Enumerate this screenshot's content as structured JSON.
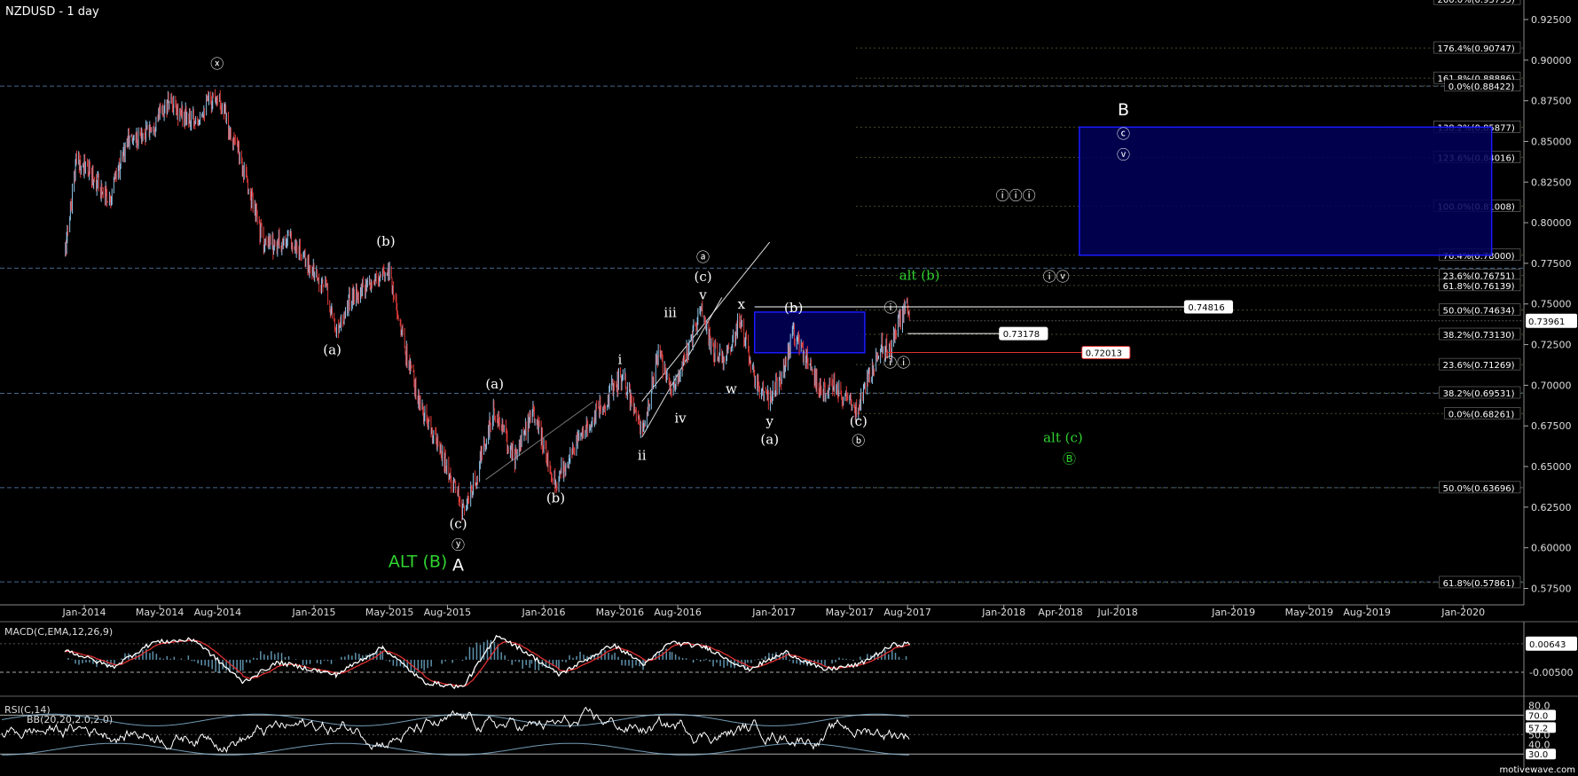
{
  "title": "NZDUSD - 1 day",
  "watermark": "motivewave.com",
  "colors": {
    "background": "#000000",
    "up": "#8fc3e6",
    "down": "#e03b3b",
    "grid": "#46668c",
    "box": "#1a1aff",
    "box_fill": "#00005a",
    "green": "#2fd22f",
    "macd": "#ffffff",
    "signal": "#e03030",
    "hist": "#76b5d6"
  },
  "chart_data": [
    {
      "type": "candlestick",
      "name": "price",
      "x_ticks": [
        "Jan-2014",
        "May-2014",
        "Aug-2014",
        "Jan-2015",
        "May-2015",
        "Aug-2015",
        "Jan-2016",
        "May-2016",
        "Aug-2016",
        "Jan-2017",
        "May-2017",
        "Aug-2017",
        "Jan-2018",
        "Apr-2018",
        "Jul-2018",
        "Jan-2019",
        "May-2019",
        "Aug-2019",
        "Jan-2020"
      ],
      "y_ticks": [
        "0.92500",
        "0.90000",
        "0.87500",
        "0.85000",
        "0.82500",
        "0.80000",
        "0.77500",
        "0.75000",
        "0.72500",
        "0.70000",
        "0.67500",
        "0.65000",
        "0.62500",
        "0.60000",
        "0.57500"
      ],
      "ylim": [
        0.566,
        0.937
      ],
      "last_price": "0.73961",
      "last_price_hidden": "0.74287",
      "anchor_points": [
        {
          "date": "2013-12-01",
          "price": 0.78
        },
        {
          "date": "2013-12-20",
          "price": 0.84
        },
        {
          "date": "2014-01-15",
          "price": 0.828
        },
        {
          "date": "2014-02-10",
          "price": 0.815
        },
        {
          "date": "2014-03-10",
          "price": 0.85
        },
        {
          "date": "2014-04-10",
          "price": 0.856
        },
        {
          "date": "2014-05-15",
          "price": 0.873
        },
        {
          "date": "2014-06-20",
          "price": 0.862
        },
        {
          "date": "2014-07-31",
          "price": 0.88
        },
        {
          "date": "2014-09-05",
          "price": 0.84
        },
        {
          "date": "2014-10-15",
          "price": 0.785
        },
        {
          "date": "2014-11-25",
          "price": 0.79
        },
        {
          "date": "2014-12-20",
          "price": 0.775
        },
        {
          "date": "2015-01-20",
          "price": 0.76
        },
        {
          "date": "2015-02-05",
          "price": 0.733
        },
        {
          "date": "2015-03-01",
          "price": 0.755
        },
        {
          "date": "2015-04-01",
          "price": 0.76
        },
        {
          "date": "2015-04-30",
          "price": 0.772
        },
        {
          "date": "2015-05-25",
          "price": 0.723
        },
        {
          "date": "2015-06-20",
          "price": 0.685
        },
        {
          "date": "2015-07-25",
          "price": 0.655
        },
        {
          "date": "2015-08-24",
          "price": 0.625
        },
        {
          "date": "2015-09-05",
          "price": 0.63
        },
        {
          "date": "2015-10-15",
          "price": 0.685
        },
        {
          "date": "2015-11-15",
          "price": 0.655
        },
        {
          "date": "2015-12-15",
          "price": 0.683
        },
        {
          "date": "2016-01-20",
          "price": 0.64
        },
        {
          "date": "2016-03-01",
          "price": 0.67
        },
        {
          "date": "2016-04-15",
          "price": 0.695
        },
        {
          "date": "2016-05-05",
          "price": 0.707
        },
        {
          "date": "2016-06-05",
          "price": 0.67
        },
        {
          "date": "2016-07-01",
          "price": 0.72
        },
        {
          "date": "2016-07-25",
          "price": 0.698
        },
        {
          "date": "2016-09-07",
          "price": 0.745
        },
        {
          "date": "2016-09-25",
          "price": 0.722
        },
        {
          "date": "2016-10-15",
          "price": 0.715
        },
        {
          "date": "2016-11-08",
          "price": 0.74
        },
        {
          "date": "2016-12-01",
          "price": 0.705
        },
        {
          "date": "2016-12-23",
          "price": 0.69
        },
        {
          "date": "2017-01-15",
          "price": 0.708
        },
        {
          "date": "2017-02-01",
          "price": 0.733
        },
        {
          "date": "2017-02-20",
          "price": 0.718
        },
        {
          "date": "2017-03-15",
          "price": 0.698
        },
        {
          "date": "2017-04-10",
          "price": 0.7
        },
        {
          "date": "2017-05-10",
          "price": 0.683
        },
        {
          "date": "2017-06-10",
          "price": 0.712
        },
        {
          "date": "2017-06-20",
          "price": 0.725
        },
        {
          "date": "2017-07-05",
          "price": 0.72
        },
        {
          "date": "2017-07-27",
          "price": 0.75
        },
        {
          "date": "2017-08-01",
          "price": 0.744
        },
        {
          "date": "2017-08-07",
          "price": 0.7396
        }
      ],
      "horizontal_levels": [
        0.884,
        0.772,
        0.695,
        0.637,
        0.579
      ],
      "fib_labels": [
        {
          "label": "200.0%(0.93755)",
          "price": 0.9375
        },
        {
          "label": "176.4%(0.90747)",
          "price": 0.9075
        },
        {
          "label": "161.8%(0.88886)",
          "price": 0.8889
        },
        {
          "label": "0.0%(0.88422)",
          "price": 0.8842
        },
        {
          "label": "138.2%(0.85877)",
          "price": 0.8588
        },
        {
          "label": "123.6%(0.84016)",
          "price": 0.8402
        },
        {
          "label": "100.0%(0.81008)",
          "price": 0.8101
        },
        {
          "label": "76.4%(0.78000)",
          "price": 0.78
        },
        {
          "label": "23.6%(0.76751)",
          "price": 0.7675
        },
        {
          "label": "61.8%(0.76139)",
          "price": 0.7614
        },
        {
          "label": "50.0%(0.74634)",
          "price": 0.7463
        },
        {
          "label": "38.2%(0.73130)",
          "price": 0.7313
        },
        {
          "label": "23.6%(0.71269)",
          "price": 0.7127
        },
        {
          "label": "38.2%(0.69531)",
          "price": 0.6953
        },
        {
          "label": "0.0%(0.68261)",
          "price": 0.6826
        },
        {
          "label": "50.0%(0.63696)",
          "price": 0.637
        },
        {
          "label": "61.8%(0.57861)",
          "price": 0.5786
        }
      ],
      "price_boxes": [
        {
          "label": "0.74816",
          "price": 0.7482,
          "color": "#ffffff",
          "start": "2016-12-01",
          "end": "2018-10-15"
        },
        {
          "label": "0.73178",
          "price": 0.7318,
          "color": "#ffffff",
          "start": "2017-08-01",
          "end": "2017-12-25"
        },
        {
          "label": "0.72013",
          "price": 0.7201,
          "color": "#e03030",
          "start": "2017-07-01",
          "end": "2018-05-05"
        }
      ],
      "target_boxes": [
        {
          "start": "2018-05-01",
          "end": "2020-02-15",
          "top": 0.8588,
          "bottom": 0.78
        },
        {
          "start": "2016-12-01",
          "end": "2017-05-25",
          "top": 0.745,
          "bottom": 0.72
        }
      ],
      "wave_labels": [
        {
          "text": "ⓧ",
          "date": "2014-07-31",
          "price": 0.895,
          "cls": "wave"
        },
        {
          "text": "(b)",
          "date": "2015-04-25",
          "price": 0.786,
          "cls": "wave"
        },
        {
          "text": "(a)",
          "date": "2015-01-30",
          "price": 0.719,
          "cls": "wave"
        },
        {
          "text": "(a)",
          "date": "2015-10-15",
          "price": 0.698,
          "cls": "wave"
        },
        {
          "text": "(b)",
          "date": "2016-01-20",
          "price": 0.628,
          "cls": "wave"
        },
        {
          "text": "(c)",
          "date": "2015-08-18",
          "price": 0.612,
          "cls": "wave"
        },
        {
          "text": "ⓨ",
          "date": "2015-08-18",
          "price": 0.599,
          "cls": "wave"
        },
        {
          "text": "A",
          "date": "2015-08-18",
          "price": 0.586,
          "cls": "wavebig"
        },
        {
          "text": "ALT (B)",
          "date": "2015-06-15",
          "price": 0.588,
          "cls": "wavebig green"
        },
        {
          "text": "i",
          "date": "2016-05-01",
          "price": 0.713,
          "cls": "wave"
        },
        {
          "text": "ii",
          "date": "2016-06-05",
          "price": 0.654,
          "cls": "wave"
        },
        {
          "text": "iii",
          "date": "2016-07-20",
          "price": 0.742,
          "cls": "wave"
        },
        {
          "text": "iv",
          "date": "2016-08-05",
          "price": 0.677,
          "cls": "wave"
        },
        {
          "text": "v",
          "date": "2016-09-10",
          "price": 0.753,
          "cls": "wave"
        },
        {
          "text": "ⓐ",
          "date": "2016-09-10",
          "price": 0.776,
          "cls": "wave"
        },
        {
          "text": "(c)",
          "date": "2016-09-10",
          "price": 0.764,
          "cls": "wave"
        },
        {
          "text": "x",
          "date": "2016-11-10",
          "price": 0.747,
          "cls": "wave"
        },
        {
          "text": "w",
          "date": "2016-10-25",
          "price": 0.695,
          "cls": "wave"
        },
        {
          "text": "y",
          "date": "2016-12-25",
          "price": 0.675,
          "cls": "wave"
        },
        {
          "text": "(a)",
          "date": "2016-12-25",
          "price": 0.664,
          "cls": "wave"
        },
        {
          "text": "(b)",
          "date": "2017-02-01",
          "price": 0.745,
          "cls": "wave"
        },
        {
          "text": "(c)",
          "date": "2017-05-15",
          "price": 0.675,
          "cls": "wave"
        },
        {
          "text": "ⓑ",
          "date": "2017-05-15",
          "price": 0.663,
          "cls": "wave"
        },
        {
          "text": "ⓘ",
          "date": "2017-07-05",
          "price": 0.745,
          "cls": "wave"
        },
        {
          "text": "ⓘⓘ",
          "date": "2017-07-15",
          "price": 0.711,
          "cls": "wave"
        },
        {
          "text": "alt (b)",
          "date": "2017-08-20",
          "price": 0.765,
          "cls": "wave green"
        },
        {
          "text": "ⓘⓘⓘ",
          "date": "2018-01-20",
          "price": 0.814,
          "cls": "wave"
        },
        {
          "text": "ⓘⓥ",
          "date": "2018-03-25",
          "price": 0.764,
          "cls": "wave"
        },
        {
          "text": "B",
          "date": "2018-07-10",
          "price": 0.866,
          "cls": "wavebig"
        },
        {
          "text": "ⓒ",
          "date": "2018-07-10",
          "price": 0.852,
          "cls": "wave"
        },
        {
          "text": "ⓥ",
          "date": "2018-07-10",
          "price": 0.839,
          "cls": "wave"
        },
        {
          "text": "alt (c)",
          "date": "2018-04-05",
          "price": 0.665,
          "cls": "wave green"
        },
        {
          "text": "Ⓑ",
          "date": "2018-04-15",
          "price": 0.652,
          "cls": "wave green"
        }
      ]
    },
    {
      "type": "line",
      "name": "MACD(C,EMA,12,26,9)",
      "title": "MACD(C,EMA,12,26,9)",
      "y_ticks": [
        "0.00643",
        "-0.00500"
      ],
      "ylim": [
        -0.0135,
        0.0145
      ],
      "series": [
        {
          "name": "MACD",
          "color": "#ffffff"
        },
        {
          "name": "Signal",
          "color": "#e03030"
        }
      ],
      "histogram_color": "#76b5d6",
      "anchor_points": [
        {
          "date": "2013-12-01",
          "v": 0.004
        },
        {
          "date": "2014-02-15",
          "v": -0.003
        },
        {
          "date": "2014-04-20",
          "v": 0.007
        },
        {
          "date": "2014-06-25",
          "v": 0.008
        },
        {
          "date": "2014-09-10",
          "v": -0.009
        },
        {
          "date": "2014-11-05",
          "v": -0.001
        },
        {
          "date": "2015-02-05",
          "v": -0.006
        },
        {
          "date": "2015-04-20",
          "v": 0.005
        },
        {
          "date": "2015-06-25",
          "v": -0.009
        },
        {
          "date": "2015-08-25",
          "v": -0.011
        },
        {
          "date": "2015-10-20",
          "v": 0.01
        },
        {
          "date": "2015-12-10",
          "v": 0.002
        },
        {
          "date": "2016-01-25",
          "v": -0.006
        },
        {
          "date": "2016-04-20",
          "v": 0.006
        },
        {
          "date": "2016-06-10",
          "v": -0.002
        },
        {
          "date": "2016-07-20",
          "v": 0.007
        },
        {
          "date": "2016-09-15",
          "v": 0.005
        },
        {
          "date": "2016-11-20",
          "v": -0.004
        },
        {
          "date": "2017-01-20",
          "v": 0.003
        },
        {
          "date": "2017-03-20",
          "v": -0.004
        },
        {
          "date": "2017-05-15",
          "v": -0.002
        },
        {
          "date": "2017-07-10",
          "v": 0.006
        },
        {
          "date": "2017-08-07",
          "v": 0.0064
        }
      ]
    },
    {
      "type": "line",
      "name": "RSI(C,14)",
      "title": "RSI(C,14)",
      "subtitle": "BB(20,20,2.0,2.0)",
      "y_ticks": [
        "80.0",
        "70.0",
        "57.2",
        "50.0",
        "40.0",
        "30.0"
      ],
      "ylim": [
        22,
        84
      ],
      "levels": [
        70,
        30
      ],
      "last_value": "57.2",
      "series": [
        {
          "name": "RSI",
          "color": "#ffffff"
        },
        {
          "name": "Bands",
          "color": "#8fc3e6"
        }
      ]
    }
  ]
}
